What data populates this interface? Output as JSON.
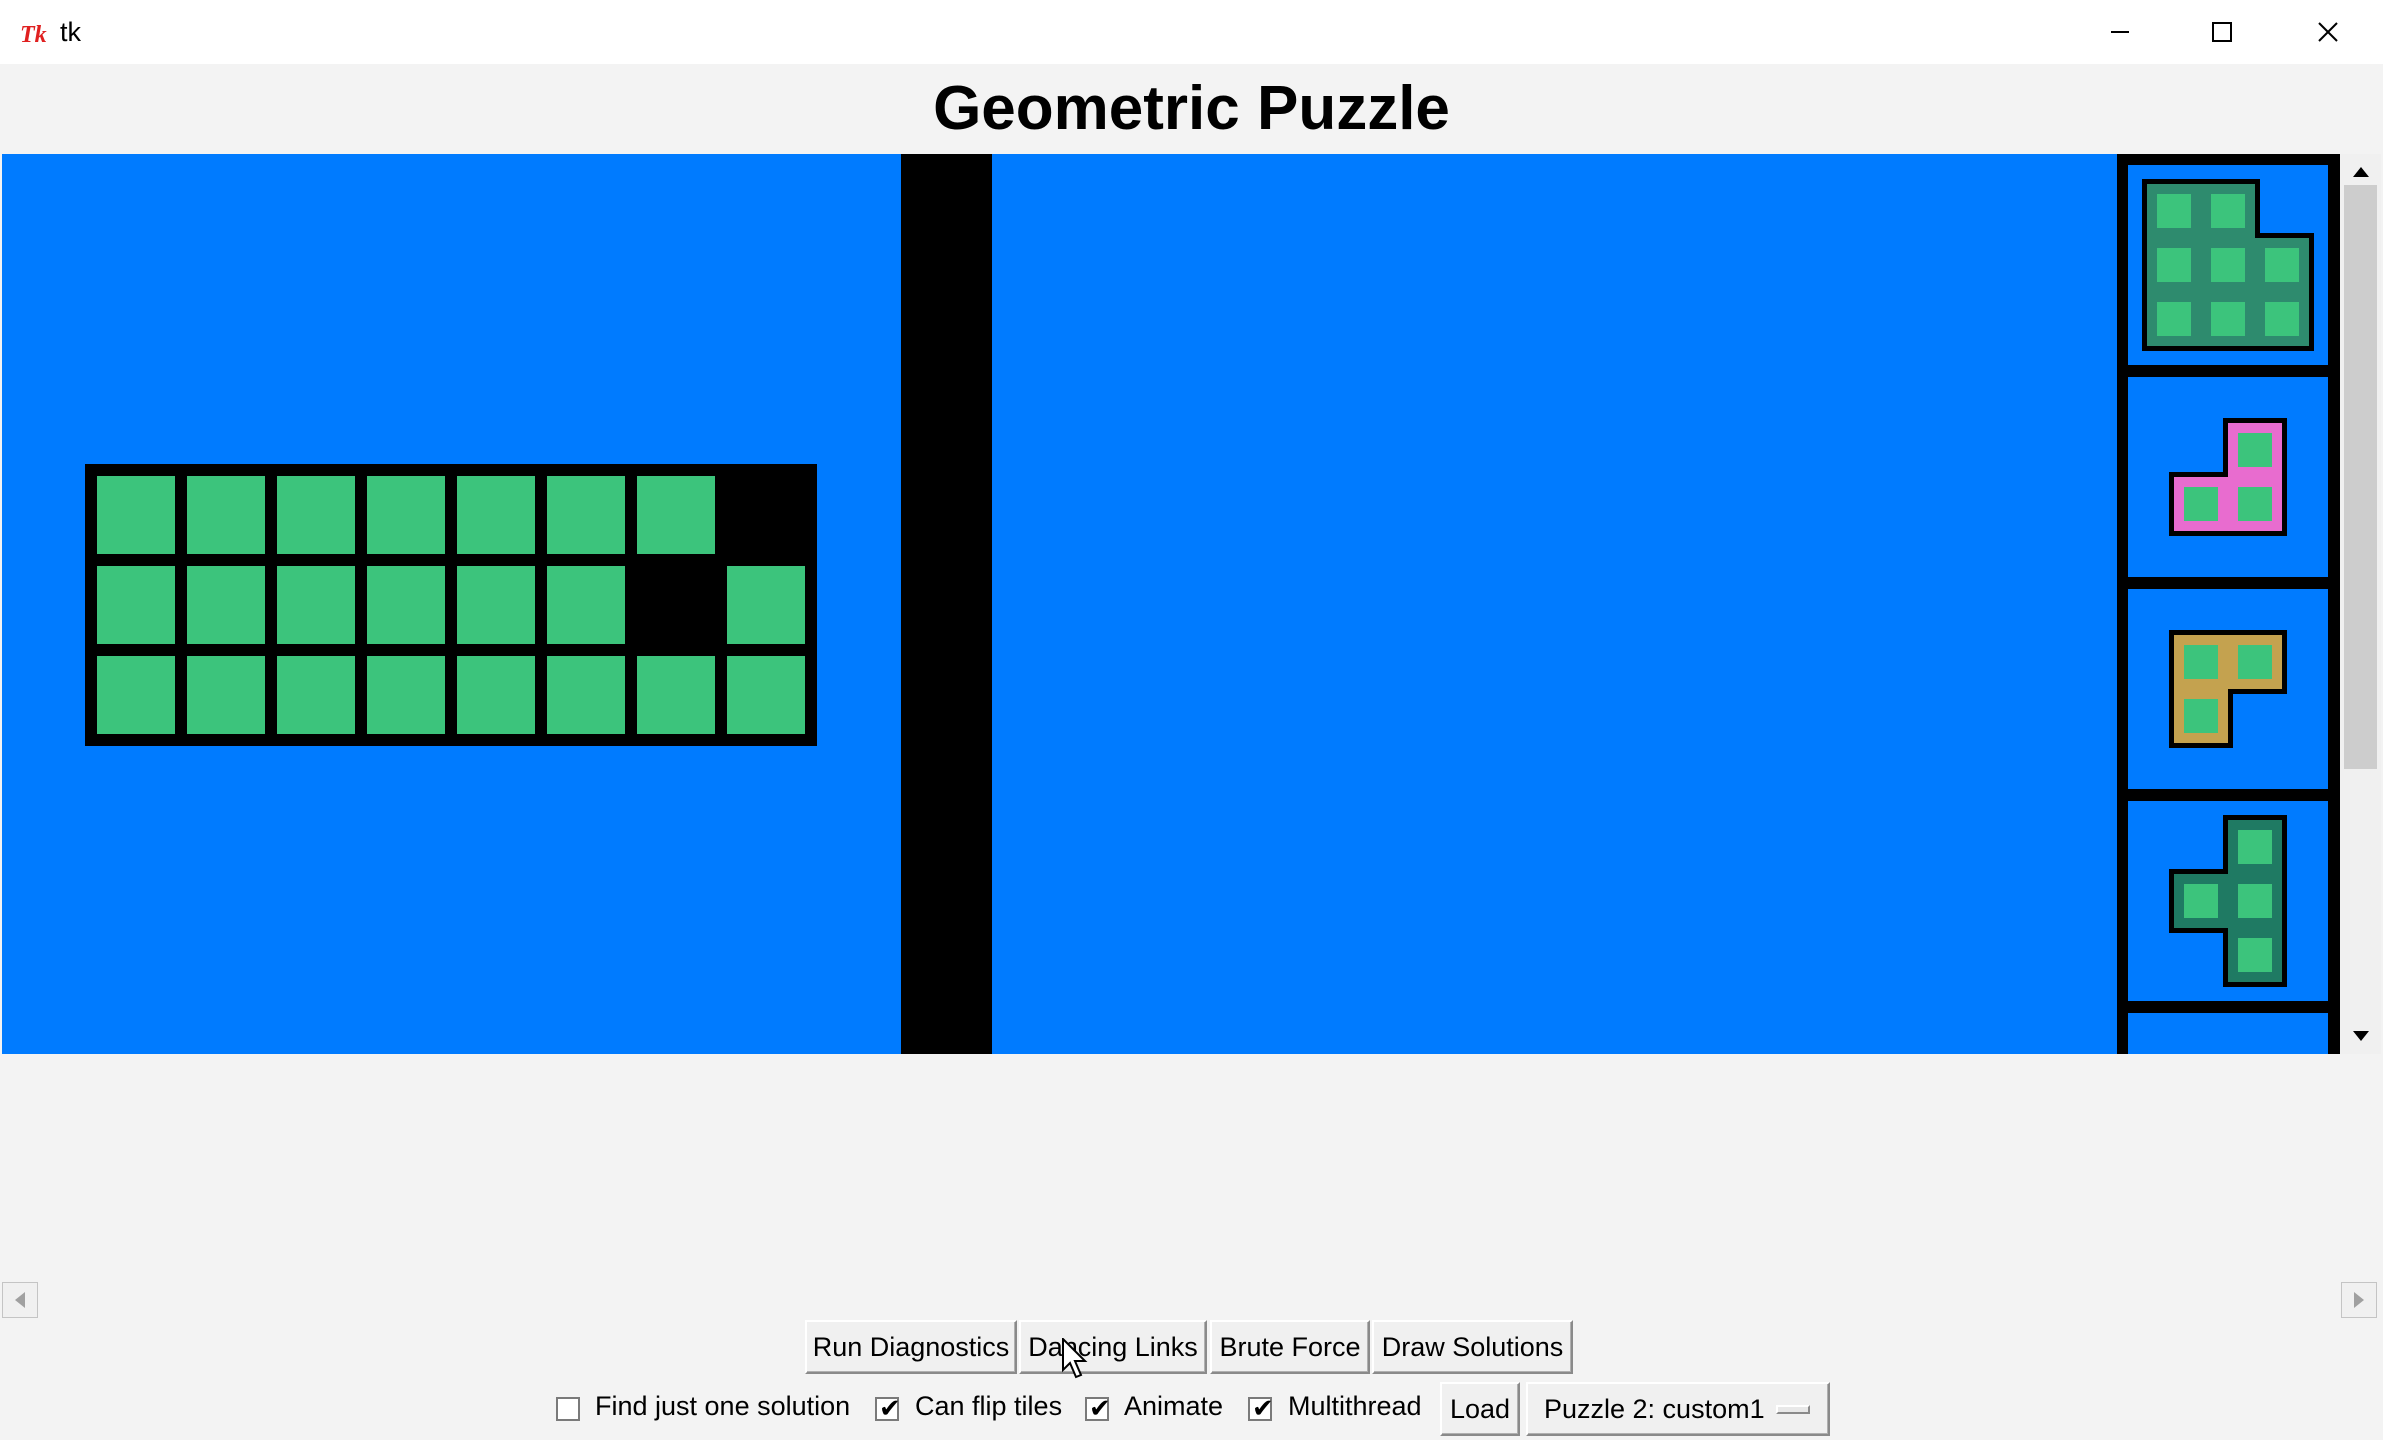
{
  "window": {
    "title": "tk",
    "controls": {
      "minimize": "minimize-icon",
      "maximize": "maximize-icon",
      "close": "close-icon"
    }
  },
  "heading": "Geometric Puzzle",
  "colors": {
    "canvas": "#007bff",
    "tile_green": "#3cc47c",
    "board_bg": "#000000",
    "piece1": "#2e8b6e",
    "piece2": "#e86ccf",
    "piece3": "#c4a24f",
    "piece4": "#1f7a63"
  },
  "board": {
    "rows": 3,
    "cols": 8,
    "filled": [
      [
        1,
        1,
        1,
        1,
        1,
        1,
        1,
        0
      ],
      [
        1,
        1,
        1,
        1,
        1,
        1,
        0,
        1
      ],
      [
        1,
        1,
        1,
        1,
        1,
        1,
        1,
        1
      ]
    ]
  },
  "pieces": [
    {
      "name": "piece-1",
      "color": "#2e8b6e",
      "cells": [
        [
          0,
          0
        ],
        [
          0,
          1
        ],
        [
          1,
          0
        ],
        [
          1,
          1
        ],
        [
          1,
          2
        ],
        [
          2,
          0
        ],
        [
          2,
          1
        ],
        [
          2,
          2
        ]
      ]
    },
    {
      "name": "piece-2",
      "color": "#e86ccf",
      "cells": [
        [
          0,
          1
        ],
        [
          1,
          0
        ],
        [
          1,
          1
        ]
      ]
    },
    {
      "name": "piece-3",
      "color": "#c4a24f",
      "cells": [
        [
          0,
          0
        ],
        [
          0,
          1
        ],
        [
          1,
          0
        ]
      ]
    },
    {
      "name": "piece-4",
      "color": "#1f7a63",
      "cells": [
        [
          0,
          1
        ],
        [
          1,
          0
        ],
        [
          1,
          1
        ],
        [
          2,
          1
        ]
      ]
    }
  ],
  "buttons": {
    "run_diagnostics": "Run Diagnostics",
    "dancing_links": "Dancing Links",
    "brute_force": "Brute Force",
    "draw_solutions": "Draw Solutions",
    "load": "Load"
  },
  "options": {
    "find_one": {
      "label": "Find just one solution",
      "checked": false
    },
    "can_flip": {
      "label": "Can flip tiles",
      "checked": true
    },
    "animate": {
      "label": "Animate",
      "checked": true
    },
    "multithread": {
      "label": "Multithread",
      "checked": true
    }
  },
  "puzzle_select": {
    "selected": "Puzzle 2: custom1"
  }
}
